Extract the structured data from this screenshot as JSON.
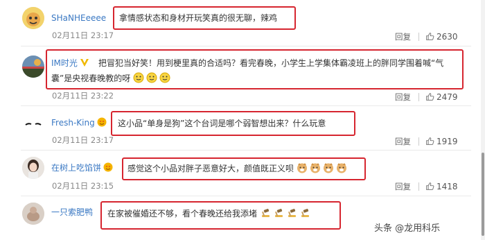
{
  "comments": [
    {
      "username": "SHaNHEeeee",
      "text": "拿情感状态和身材开玩笑真的很无聊，辣鸡",
      "date": "02月11日 23:17",
      "reply_label": "回复",
      "likes": "2630"
    },
    {
      "username": "IM时光",
      "text_line1": "把冒犯当好笑！用到梗里真的合适吗？看完春晚，小学生上学集体霸凌班上的胖同学围着喊“气",
      "text_line2": "囊”是央视春晚教的呀",
      "date": "02月11日 23:22",
      "reply_label": "回复",
      "likes": "2479"
    },
    {
      "username": "Fresh-King",
      "text": "这小品“单身是狗”这个台词是哪个弱智想出来？什么玩意",
      "date": "02月11日 23:17",
      "reply_label": "回复",
      "likes": "1919"
    },
    {
      "username": "在树上吃馅饼",
      "text": "感觉这个小品对胖子恶意好大，颜值既正义呗",
      "date": "02月11日 23:15",
      "reply_label": "回复",
      "likes": "1418"
    },
    {
      "username": "一只索肥鸭",
      "text": "在家被催婚还不够，看个春晚还给我添堵",
      "date": "",
      "reply_label": "",
      "likes": ""
    }
  ],
  "watermark": "头条 @龙用科乐",
  "colors": {
    "username": "#3a78c3",
    "highlight_box": "#d6252f"
  }
}
